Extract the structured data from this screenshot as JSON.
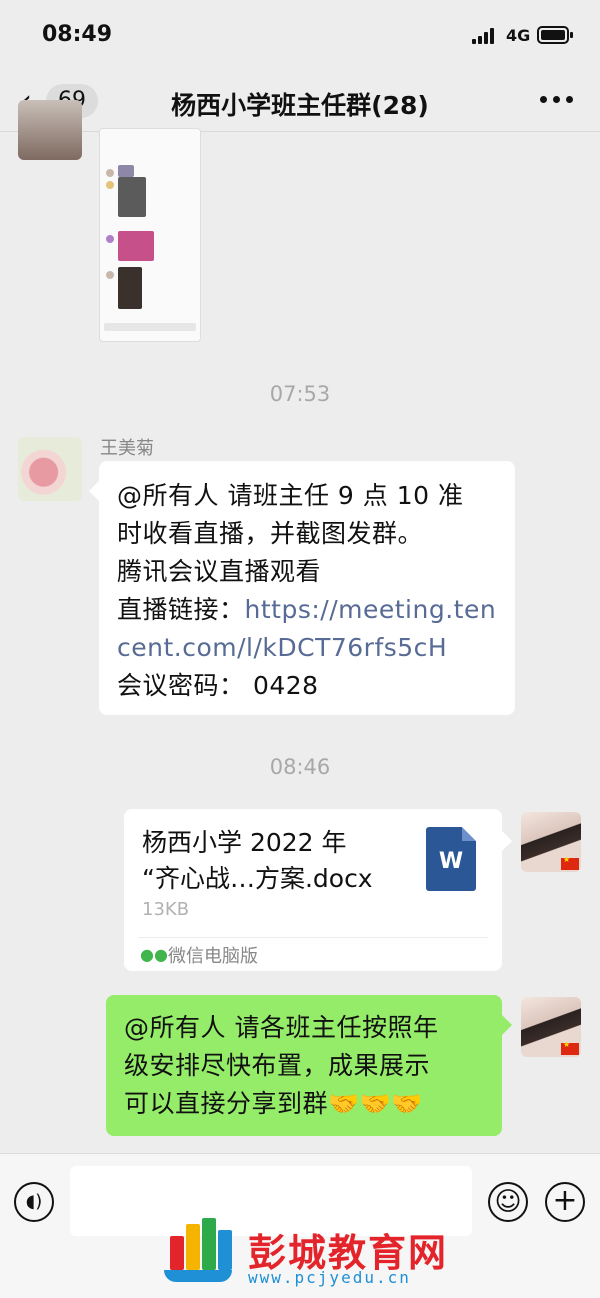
{
  "status_bar": {
    "time": "08:49",
    "network": "4G"
  },
  "header": {
    "back_count": "69",
    "title": "杨西小学班主任群(28)"
  },
  "messages": {
    "timestamp_1": "07:53",
    "msg1": {
      "sender": "王美菊",
      "lines": [
        "@所有人  请班主任 9 点 10 准",
        "时收看直播，并截图发群。",
        "腾讯会议直播观看",
        "直播链接：",
        "https://meeting.ten",
        "cent.com/l/kDCT76rfs5cH",
        "会议密码：  0428"
      ]
    },
    "timestamp_2": "08:46",
    "file": {
      "name_line1": "杨西小学 2022 年",
      "name_line2": "“齐心战…方案.docx",
      "size": "13KB",
      "icon_letter": "W",
      "source": "微信电脑版"
    },
    "msg2": {
      "lines": [
        "@所有人 请各班主任按照年",
        "级安排尽快布置，成果展示",
        "可以直接分享到群"
      ],
      "emoji": "🤝🤝🤝"
    }
  },
  "input_bar": {
    "placeholder": ""
  },
  "watermark": {
    "name": "彭城教育网",
    "url": "www.pcjyedu.cn"
  },
  "icons": {
    "back": "chevron-left-icon",
    "more": "more-dots-icon",
    "voice": "voice-icon",
    "emoji": "emoji-icon",
    "plus": "plus-icon",
    "word": "word-document-icon",
    "wechat": "wechat-icon"
  }
}
